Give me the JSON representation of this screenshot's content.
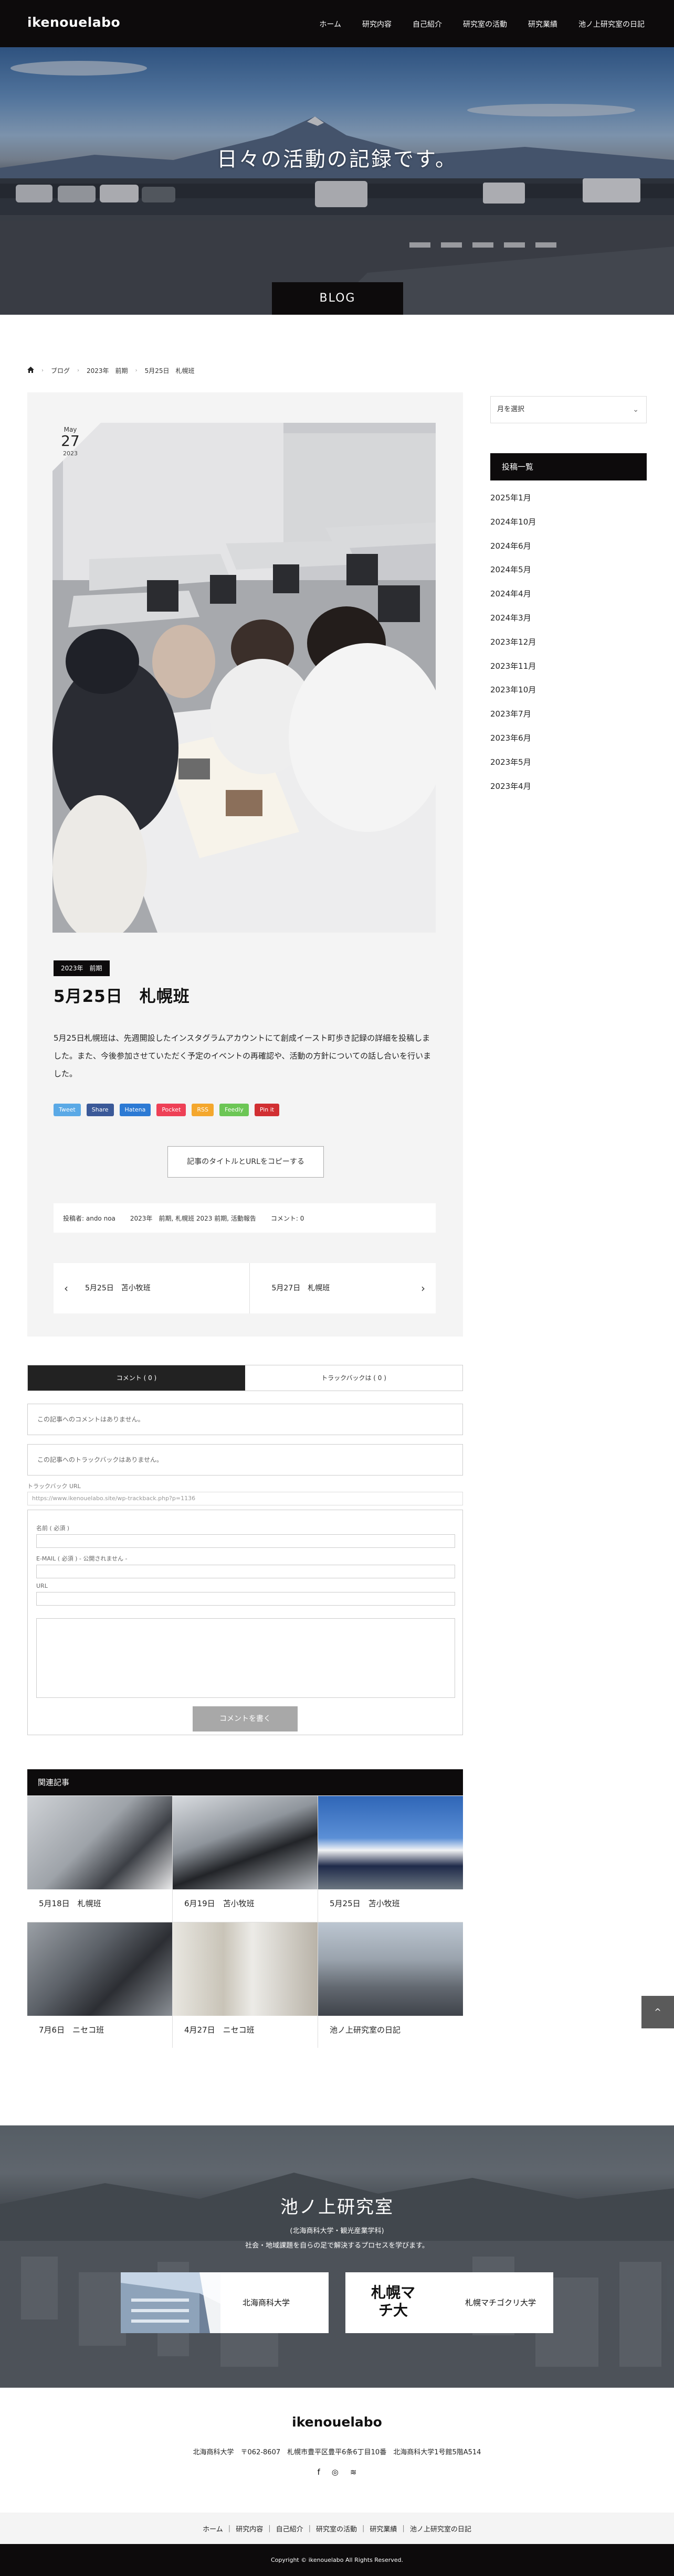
{
  "header": {
    "logo": "ikenouelabo",
    "nav": [
      "ホーム",
      "研究内容",
      "自己紹介",
      "研究室の活動",
      "研究業績",
      "池ノ上研究室の日記"
    ]
  },
  "hero": {
    "title": "日々の活動の記録です。",
    "tab": "BLOG"
  },
  "breadcrumb": [
    "ブログ",
    "2023年　前期",
    "5月25日　札幌班"
  ],
  "post": {
    "date": {
      "month": "May",
      "day": "27",
      "year": "2023"
    },
    "category": "2023年　前期",
    "title": "5月25日　札幌班",
    "body": "5月25日札幌班は、先週開設したインスタグラムアカウントにて創成イースト町歩き記録の詳細を投稿しました。また、今後参加させていただく予定のイベントの再確認や、活動の方針についての話し合いを行いました。",
    "share": [
      {
        "label": "Tweet",
        "color": "#5aa9e6"
      },
      {
        "label": "Share",
        "color": "#3b5998"
      },
      {
        "label": "Hatena",
        "color": "#2c7ad4"
      },
      {
        "label": "Pocket",
        "color": "#ee4056"
      },
      {
        "label": "RSS",
        "color": "#f4a72d"
      },
      {
        "label": "Feedly",
        "color": "#6cc655"
      },
      {
        "label": "Pin it",
        "color": "#d12f32"
      }
    ],
    "copy_button": "記事のタイトルとURLをコピーする",
    "meta": {
      "author": "投稿者: ando noa",
      "tags": "2023年　前期, 札幌班 2023 前期, 活動報告",
      "comments": "コメント: 0"
    },
    "prev_label": "5月25日　苫小牧班",
    "next_label": "5月27日　札幌班"
  },
  "sidebar": {
    "select_placeholder": "月を選択",
    "heading": "投稿一覧",
    "archives": [
      "2025年1月",
      "2024年10月",
      "2024年6月",
      "2024年5月",
      "2024年4月",
      "2024年3月",
      "2023年12月",
      "2023年11月",
      "2023年10月",
      "2023年7月",
      "2023年6月",
      "2023年5月",
      "2023年4月"
    ]
  },
  "comments": {
    "tab_comments": "コメント ( 0 )",
    "tab_trackbacks": "トラックバックは ( 0 )",
    "no_comments": "この記事へのコメントはありません。",
    "no_trackbacks": "この記事へのトラックバックはありません。",
    "trackback_label": "トラックバック URL",
    "trackback_url": "https://www.ikenouelabo.site/wp-trackback.php?p=1136",
    "name_label": "名前 ( 必須 )",
    "email_label": "E-MAIL ( 必須 ) - 公開されません -",
    "url_label": "URL",
    "submit": "コメントを書く"
  },
  "related": {
    "heading": "関連記事",
    "items": [
      "5月18日　札幌班",
      "6月19日　苫小牧班",
      "5月25日　苫小牧班",
      "7月6日　ニセコ班",
      "4月27日　ニセコ班",
      "池ノ上研究室の日記"
    ]
  },
  "banner": {
    "title": "池ノ上研究室",
    "sub1": "(北海商科大学・観光産業学科)",
    "sub2": "社会・地域課題を自らの足で解決するプロセスを学びます。",
    "card1": "北海商科大学",
    "card2": "札幌マチゴクリ大学",
    "card2_logo": "札幌マチ大"
  },
  "footer": {
    "logo": "ikenouelabo",
    "address": "北海商科大学　〒062-8607　札幌市豊平区豊平6条6丁目10番　北海商科大学1号館5階A514",
    "social": [
      "f",
      "◎",
      "≋"
    ],
    "nav": [
      "ホーム",
      "研究内容",
      "自己紹介",
      "研究室の活動",
      "研究業績",
      "池ノ上研究室の日記"
    ],
    "copyright": "Copyright © ikenouelabo All Rights Reserved."
  },
  "page_top": "^"
}
